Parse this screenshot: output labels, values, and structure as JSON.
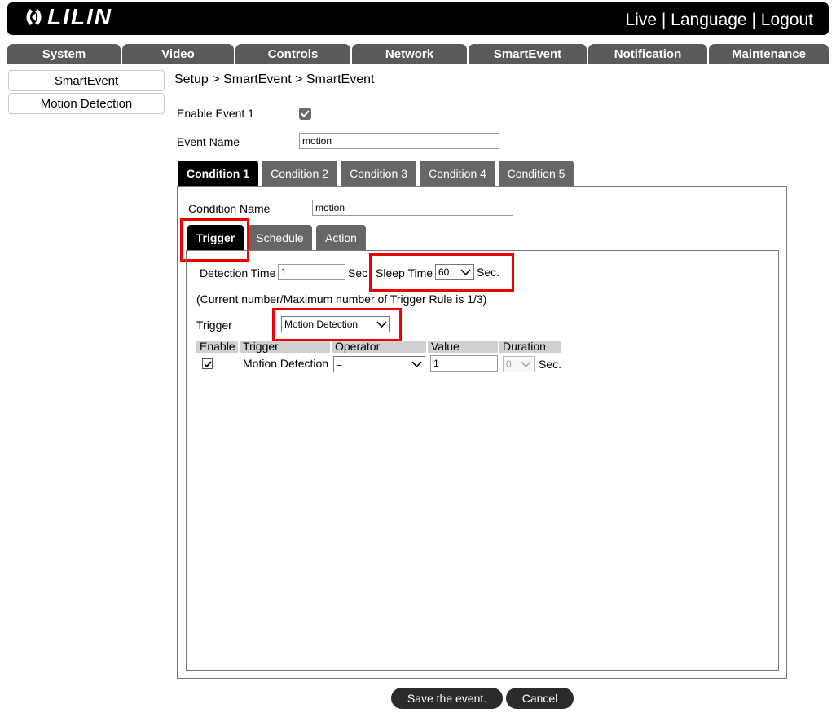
{
  "header": {
    "logo_text": "LILIN",
    "links": [
      "Live",
      "Language",
      "Logout"
    ],
    "separator": "|"
  },
  "nav": [
    "System",
    "Video",
    "Controls",
    "Network",
    "SmartEvent",
    "Notification",
    "Maintenance"
  ],
  "sidebar": [
    "SmartEvent",
    "Motion Detection"
  ],
  "breadcrumb": "Setup > SmartEvent > SmartEvent",
  "event": {
    "enable_label": "Enable Event 1",
    "enable_checked": true,
    "name_label": "Event Name",
    "name_value": "motion"
  },
  "condition_tabs": [
    "Condition 1",
    "Condition 2",
    "Condition 3",
    "Condition 4",
    "Condition 5"
  ],
  "active_condition": 0,
  "condition": {
    "name_label": "Condition Name",
    "name_value": "motion"
  },
  "sub_tabs": [
    "Trigger",
    "Schedule",
    "Action"
  ],
  "active_sub_tab": 0,
  "trigger": {
    "detection_time_label": "Detection Time",
    "detection_time_value": "1",
    "sec_label": "Sec.",
    "sleep_time_label": "Sleep Time",
    "sleep_time_value": "60",
    "rule_count_text": "(Current number/Maximum number of Trigger Rule is 1/3)",
    "trigger_label": "Trigger",
    "trigger_select_value": "Motion Detection",
    "table_headers": [
      "Enable",
      "Trigger",
      "Operator",
      "Value",
      "Duration"
    ],
    "rows": [
      {
        "enabled": true,
        "trigger": "Motion Detection",
        "operator": "=",
        "value": "1",
        "duration": "0",
        "unit": "Sec."
      }
    ]
  },
  "buttons": {
    "save": "Save the event.",
    "cancel": "Cancel"
  },
  "colors": {
    "highlight": "#e00000",
    "tab_active": "#000000",
    "tab_inactive": "#666666",
    "nav_bg": "#5a5a5a"
  }
}
